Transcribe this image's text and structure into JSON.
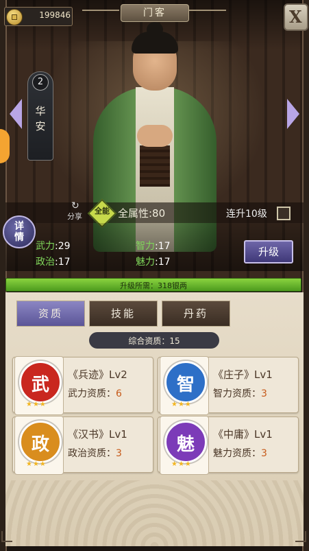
{
  "currency": {
    "icon": "coin-icon",
    "amount": "199846"
  },
  "window": {
    "title": "门客",
    "close_label": "X"
  },
  "character": {
    "rank": "2",
    "name_line1": "华",
    "name_line2": "安"
  },
  "attributes": {
    "share_label": "分享",
    "all_badge": "全能",
    "all_attr_label": "全属性:80",
    "chain_upgrade_label": "连升10级",
    "detail_label_1": "详",
    "detail_label_2": "情",
    "stats": [
      {
        "key": "武力",
        "value": ":29"
      },
      {
        "key": "智力",
        "value": ":17"
      },
      {
        "key": "政治",
        "value": ":17"
      },
      {
        "key": "魅力",
        "value": ":17"
      }
    ],
    "upgrade_button": "升级"
  },
  "upgrade_cost": {
    "text": "升级所需：318银两",
    "progress": 1.0
  },
  "tabs": [
    {
      "label": "资质",
      "active": true
    },
    {
      "label": "技能",
      "active": false
    },
    {
      "label": "丹药",
      "active": false
    }
  ],
  "quality": {
    "text": "综合资质：15"
  },
  "cards": [
    {
      "seal_char": "武",
      "seal_color": "#c9271f",
      "title": "《兵迹》Lv2",
      "attr_label": "武力资质：",
      "attr_value": "6",
      "stars": "★★★"
    },
    {
      "seal_char": "智",
      "seal_color": "#2d6fc7",
      "title": "《庄子》Lv1",
      "attr_label": "智力资质：",
      "attr_value": "3",
      "stars": "★★★"
    },
    {
      "seal_char": "政",
      "seal_color": "#d98d1e",
      "title": "《汉书》Lv1",
      "attr_label": "政治资质：",
      "attr_value": "3",
      "stars": "★★★"
    },
    {
      "seal_char": "魅",
      "seal_color": "#7c3bb8",
      "title": "《中庸》Lv1",
      "attr_label": "魅力资质：",
      "attr_value": "3",
      "stars": "★★★"
    }
  ]
}
